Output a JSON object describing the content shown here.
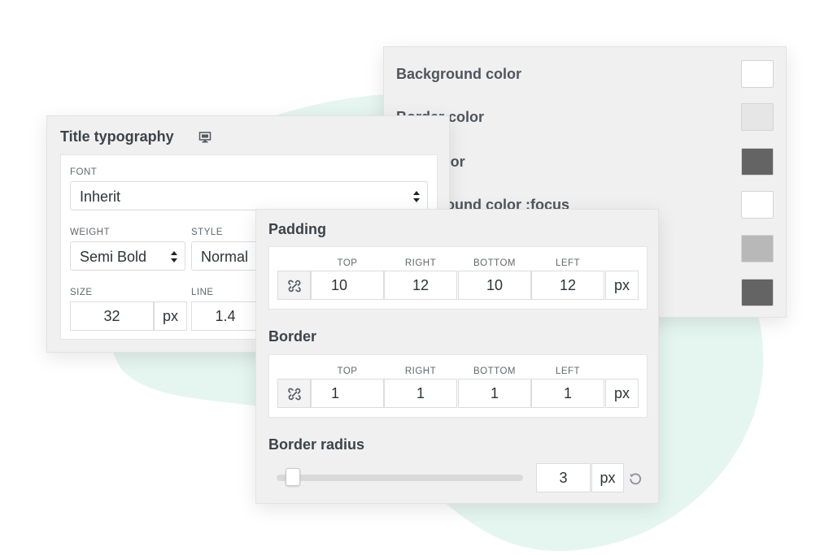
{
  "colors": {
    "mint_background": "#e5f5ef",
    "rows": [
      {
        "label": "Background color",
        "swatch": "#ffffff"
      },
      {
        "label": "Border color",
        "swatch": "#e6e6e6"
      },
      {
        "label": "Text color",
        "swatch": "#646464"
      },
      {
        "label": "Background color :focus",
        "swatch": "#ffffff"
      },
      {
        "label": "",
        "swatch": "#b8b8b8"
      },
      {
        "label": "",
        "swatch": "#646464"
      }
    ]
  },
  "typography": {
    "title": "Title typography",
    "device_icon": "desktop-icon",
    "font_label": "FONT",
    "font_value": "Inherit",
    "weight_label": "WEIGHT",
    "weight_value": "Semi Bold",
    "style_label": "STYLE",
    "style_value": "Normal",
    "size_label": "SIZE",
    "size_value": "32",
    "size_unit": "px",
    "line_label": "LINE",
    "line_value": "1.4"
  },
  "spacing": {
    "padding_title": "Padding",
    "border_title": "Border",
    "radius_title": "Border radius",
    "side_labels": [
      "TOP",
      "RIGHT",
      "BOTTOM",
      "LEFT"
    ],
    "padding_values": [
      "10",
      "12",
      "10",
      "12"
    ],
    "border_values": [
      "1",
      "1",
      "1",
      "1"
    ],
    "unit": "px",
    "link_icon": "unlink-icon",
    "radius_value": "3",
    "radius_unit": "px",
    "radius_slider_fraction": 0.04,
    "reset_icon": "reset-icon"
  }
}
